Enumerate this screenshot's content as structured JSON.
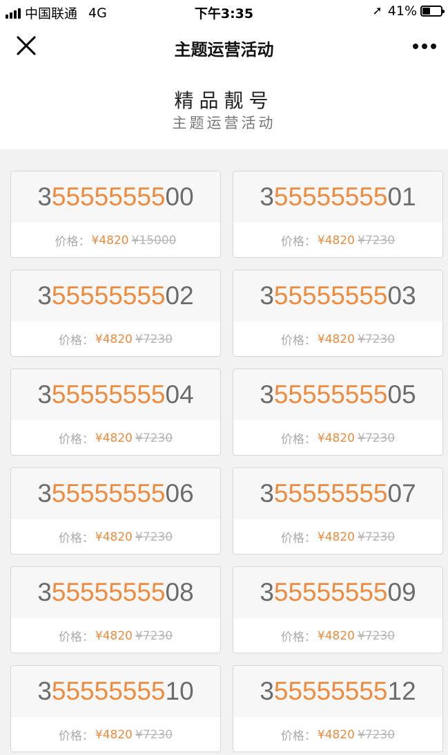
{
  "status_bar": {
    "carrier": "中国联通",
    "network": "4G",
    "time": "下午3:35",
    "battery": "41%",
    "battery_level": 0.41
  },
  "nav": {
    "title": "主题运营活动"
  },
  "header": {
    "title": "精品靓号",
    "subtitle": "主题运营活动"
  },
  "price_label": "价格：",
  "numbers": [
    {
      "prefix": "3",
      "mid": "55555555",
      "suffix": "00",
      "price": "¥4820",
      "original": "¥15000"
    },
    {
      "prefix": "3",
      "mid": "55555555",
      "suffix": "01",
      "price": "¥4820",
      "original": "¥7230"
    },
    {
      "prefix": "3",
      "mid": "55555555",
      "suffix": "02",
      "price": "¥4820",
      "original": "¥7230"
    },
    {
      "prefix": "3",
      "mid": "55555555",
      "suffix": "03",
      "price": "¥4820",
      "original": "¥7230"
    },
    {
      "prefix": "3",
      "mid": "55555555",
      "suffix": "04",
      "price": "¥4820",
      "original": "¥7230"
    },
    {
      "prefix": "3",
      "mid": "55555555",
      "suffix": "05",
      "price": "¥4820",
      "original": "¥7230"
    },
    {
      "prefix": "3",
      "mid": "55555555",
      "suffix": "06",
      "price": "¥4820",
      "original": "¥7230"
    },
    {
      "prefix": "3",
      "mid": "55555555",
      "suffix": "07",
      "price": "¥4820",
      "original": "¥7230"
    },
    {
      "prefix": "3",
      "mid": "55555555",
      "suffix": "08",
      "price": "¥4820",
      "original": "¥7230"
    },
    {
      "prefix": "3",
      "mid": "55555555",
      "suffix": "09",
      "price": "¥4820",
      "original": "¥7230"
    },
    {
      "prefix": "3",
      "mid": "55555555",
      "suffix": "10",
      "price": "¥4820",
      "original": "¥7230"
    },
    {
      "prefix": "3",
      "mid": "55555555",
      "suffix": "12",
      "price": "¥4820",
      "original": "¥7230"
    }
  ],
  "colors": {
    "accent": "#f08a3c",
    "digit_gray": "#6c6c6c",
    "background": "#f2f2f2"
  }
}
